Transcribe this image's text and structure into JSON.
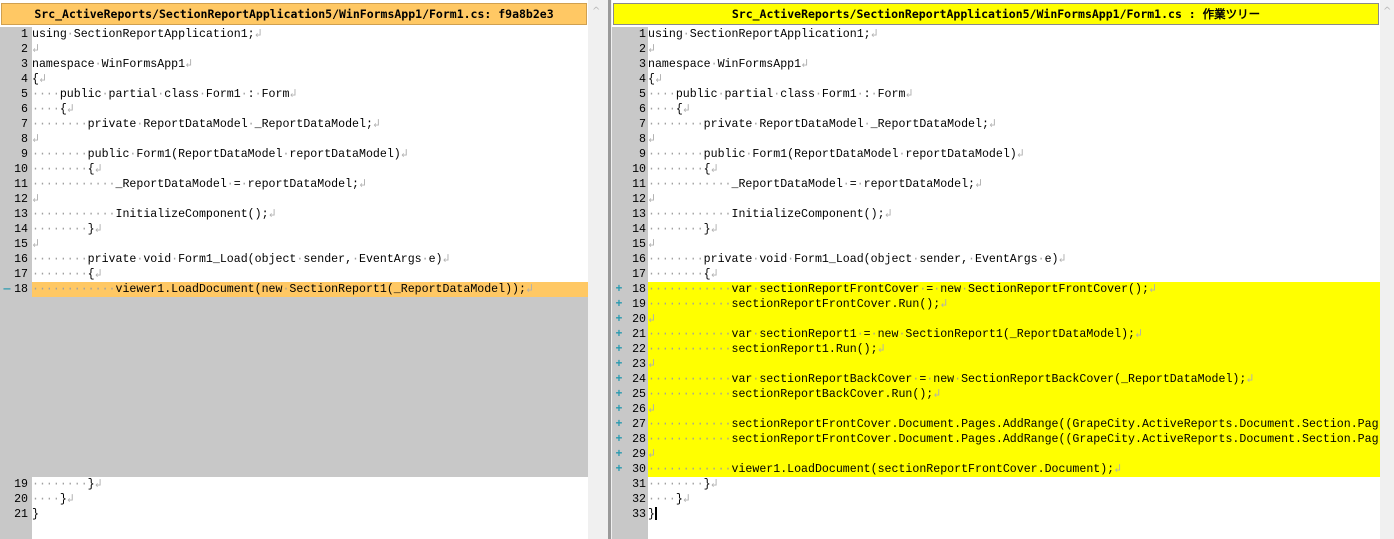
{
  "left": {
    "title": "Src_ActiveReports/SectionReportApplication5/WinFormsApp1/Form1.cs: f9a8b2e3",
    "lines": [
      {
        "n": "1",
        "t": "using SectionReportApplication1;"
      },
      {
        "n": "2",
        "t": ""
      },
      {
        "n": "3",
        "t": "namespace WinFormsApp1"
      },
      {
        "n": "4",
        "t": "{"
      },
      {
        "n": "5",
        "t": "    public partial class Form1 : Form"
      },
      {
        "n": "6",
        "t": "    {"
      },
      {
        "n": "7",
        "t": "        private ReportDataModel _ReportDataModel;"
      },
      {
        "n": "8",
        "t": ""
      },
      {
        "n": "9",
        "t": "        public Form1(ReportDataModel reportDataModel)"
      },
      {
        "n": "10",
        "t": "        {"
      },
      {
        "n": "11",
        "t": "            _ReportDataModel = reportDataModel;"
      },
      {
        "n": "12",
        "t": ""
      },
      {
        "n": "13",
        "t": "            InitializeComponent();"
      },
      {
        "n": "14",
        "t": "        }"
      },
      {
        "n": "15",
        "t": ""
      },
      {
        "n": "16",
        "t": "        private void Form1_Load(object sender, EventArgs e)"
      },
      {
        "n": "17",
        "t": "        {"
      },
      {
        "n": "18",
        "t": "            viewer1.LoadDocument(new SectionReport1(_ReportDataModel));",
        "type": "removed",
        "mark": "minus"
      },
      {
        "n": "",
        "t": null,
        "type": "empty"
      },
      {
        "n": "",
        "t": null,
        "type": "empty"
      },
      {
        "n": "",
        "t": null,
        "type": "empty"
      },
      {
        "n": "",
        "t": null,
        "type": "empty"
      },
      {
        "n": "",
        "t": null,
        "type": "empty"
      },
      {
        "n": "",
        "t": null,
        "type": "empty"
      },
      {
        "n": "",
        "t": null,
        "type": "empty"
      },
      {
        "n": "",
        "t": null,
        "type": "empty"
      },
      {
        "n": "",
        "t": null,
        "type": "empty"
      },
      {
        "n": "",
        "t": null,
        "type": "empty"
      },
      {
        "n": "",
        "t": null,
        "type": "empty"
      },
      {
        "n": "",
        "t": null,
        "type": "empty"
      },
      {
        "n": "19",
        "t": "        }"
      },
      {
        "n": "20",
        "t": "    }"
      },
      {
        "n": "21",
        "t": "}",
        "noeol": true
      }
    ]
  },
  "right": {
    "title": "Src_ActiveReports/SectionReportApplication5/WinFormsApp1/Form1.cs : 作業ツリー",
    "lines": [
      {
        "n": "1",
        "t": "using SectionReportApplication1;"
      },
      {
        "n": "2",
        "t": ""
      },
      {
        "n": "3",
        "t": "namespace WinFormsApp1"
      },
      {
        "n": "4",
        "t": "{"
      },
      {
        "n": "5",
        "t": "    public partial class Form1 : Form"
      },
      {
        "n": "6",
        "t": "    {"
      },
      {
        "n": "7",
        "t": "        private ReportDataModel _ReportDataModel;"
      },
      {
        "n": "8",
        "t": ""
      },
      {
        "n": "9",
        "t": "        public Form1(ReportDataModel reportDataModel)"
      },
      {
        "n": "10",
        "t": "        {"
      },
      {
        "n": "11",
        "t": "            _ReportDataModel = reportDataModel;"
      },
      {
        "n": "12",
        "t": ""
      },
      {
        "n": "13",
        "t": "            InitializeComponent();"
      },
      {
        "n": "14",
        "t": "        }"
      },
      {
        "n": "15",
        "t": ""
      },
      {
        "n": "16",
        "t": "        private void Form1_Load(object sender, EventArgs e)"
      },
      {
        "n": "17",
        "t": "        {"
      },
      {
        "n": "18",
        "t": "            var sectionReportFrontCover = new SectionReportFrontCover();",
        "type": "added",
        "mark": "plus"
      },
      {
        "n": "19",
        "t": "            sectionReportFrontCover.Run();",
        "type": "added",
        "mark": "plus"
      },
      {
        "n": "20",
        "t": "",
        "type": "added",
        "mark": "plus"
      },
      {
        "n": "21",
        "t": "            var sectionReport1 = new SectionReport1(_ReportDataModel);",
        "type": "added",
        "mark": "plus"
      },
      {
        "n": "22",
        "t": "            sectionReport1.Run();",
        "type": "added",
        "mark": "plus"
      },
      {
        "n": "23",
        "t": "",
        "type": "added",
        "mark": "plus"
      },
      {
        "n": "24",
        "t": "            var sectionReportBackCover = new SectionReportBackCover(_ReportDataModel);",
        "type": "added",
        "mark": "plus"
      },
      {
        "n": "25",
        "t": "            sectionReportBackCover.Run();",
        "type": "added",
        "mark": "plus"
      },
      {
        "n": "26",
        "t": "",
        "type": "added",
        "mark": "plus"
      },
      {
        "n": "27",
        "t": "            sectionReportFrontCover.Document.Pages.AddRange((GrapeCity.ActiveReports.Document.Section.Pag",
        "type": "added",
        "mark": "plus",
        "noeol": true
      },
      {
        "n": "28",
        "t": "            sectionReportFrontCover.Document.Pages.AddRange((GrapeCity.ActiveReports.Document.Section.Pag",
        "type": "added",
        "mark": "plus",
        "noeol": true
      },
      {
        "n": "29",
        "t": "",
        "type": "added",
        "mark": "plus"
      },
      {
        "n": "30",
        "t": "            viewer1.LoadDocument(sectionReportFrontCover.Document);",
        "type": "added",
        "mark": "plus"
      },
      {
        "n": "31",
        "t": "        }"
      },
      {
        "n": "32",
        "t": "    }"
      },
      {
        "n": "33",
        "t": "}",
        "noeol": true,
        "caret": true
      }
    ]
  },
  "icons": {
    "plus": "+",
    "minus": "—",
    "eol": "↲",
    "ws": "·",
    "scroll_up": "^"
  },
  "colors": {
    "removed": "#ffc864",
    "added": "#ffff00",
    "gutter": "#c8c8c8",
    "marker": "#2a9ab0"
  }
}
